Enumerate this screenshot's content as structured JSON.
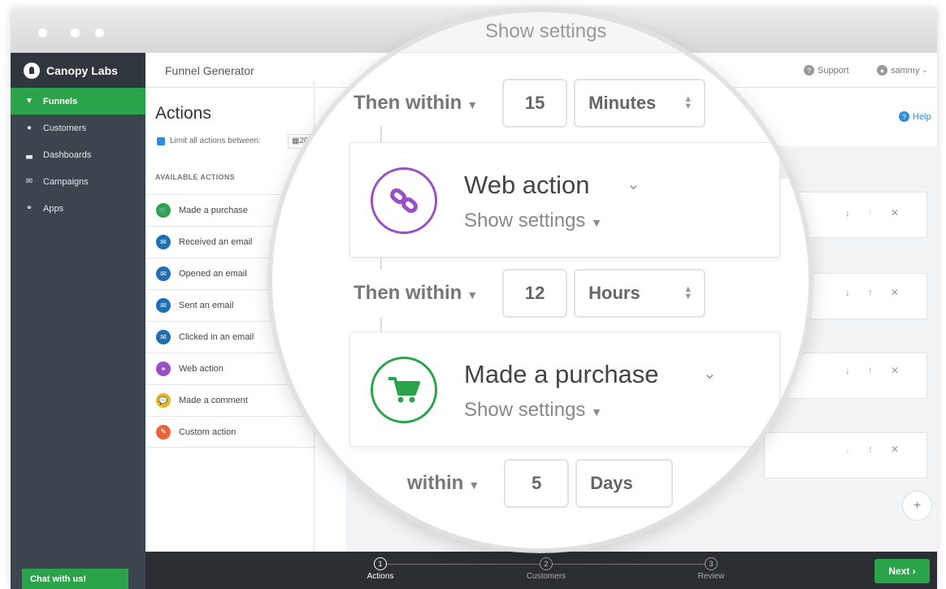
{
  "sidebar": {
    "brand": "Canopy Labs",
    "items": [
      {
        "label": "Funnels",
        "icon": "filter-icon"
      },
      {
        "label": "Customers",
        "icon": "person-icon"
      },
      {
        "label": "Dashboards",
        "icon": "chart-icon"
      },
      {
        "label": "Campaigns",
        "icon": "envelope-icon"
      },
      {
        "label": "Apps",
        "icon": "link-icon"
      }
    ],
    "chat_label": "Chat with us!"
  },
  "header": {
    "title": "Funnel Generator",
    "support_label": "Support",
    "user_label": "sammy"
  },
  "actions": {
    "title": "Actions",
    "limit_label": "Limit all actions between:",
    "date_value": "20",
    "available_heading": "AVAILABLE ACTIONS",
    "items": [
      {
        "label": "Made a purchase",
        "color": "#2aa34a",
        "icon": "cart-icon"
      },
      {
        "label": "Received an email",
        "color": "#1f6fb2",
        "icon": "envelope-icon"
      },
      {
        "label": "Opened an email",
        "color": "#1f6fb2",
        "icon": "envelope-icon"
      },
      {
        "label": "Sent an email",
        "color": "#1f6fb2",
        "icon": "envelope-icon"
      },
      {
        "label": "Clicked in an email",
        "color": "#1f6fb2",
        "icon": "envelope-icon"
      },
      {
        "label": "Web action",
        "color": "#9b4fc4",
        "icon": "link-icon"
      },
      {
        "label": "Made a comment",
        "color": "#e8b923",
        "icon": "comment-icon"
      },
      {
        "label": "Custom action",
        "color": "#e9663a",
        "icon": "pencil-icon"
      }
    ]
  },
  "help_label": "Help",
  "lens": {
    "top_text": "Show settings",
    "rows": [
      {
        "label": "Then within",
        "number": "15",
        "unit": "Minutes"
      },
      {
        "label": "Then within",
        "number": "12",
        "unit": "Hours"
      },
      {
        "label": "within",
        "number": "5",
        "unit": "Days"
      }
    ],
    "cards": [
      {
        "title": "Web action",
        "settings": "Show settings",
        "color": "#9b4fc4",
        "icon": "link-icon"
      },
      {
        "title": "Made a purchase",
        "settings": "Show settings",
        "color": "#2aa34a",
        "icon": "cart-icon"
      }
    ]
  },
  "steps": [
    {
      "num": "1",
      "label": "Actions"
    },
    {
      "num": "2",
      "label": "Customers"
    },
    {
      "num": "3",
      "label": "Review"
    }
  ],
  "next_label": "Next ›",
  "add_label": "+"
}
